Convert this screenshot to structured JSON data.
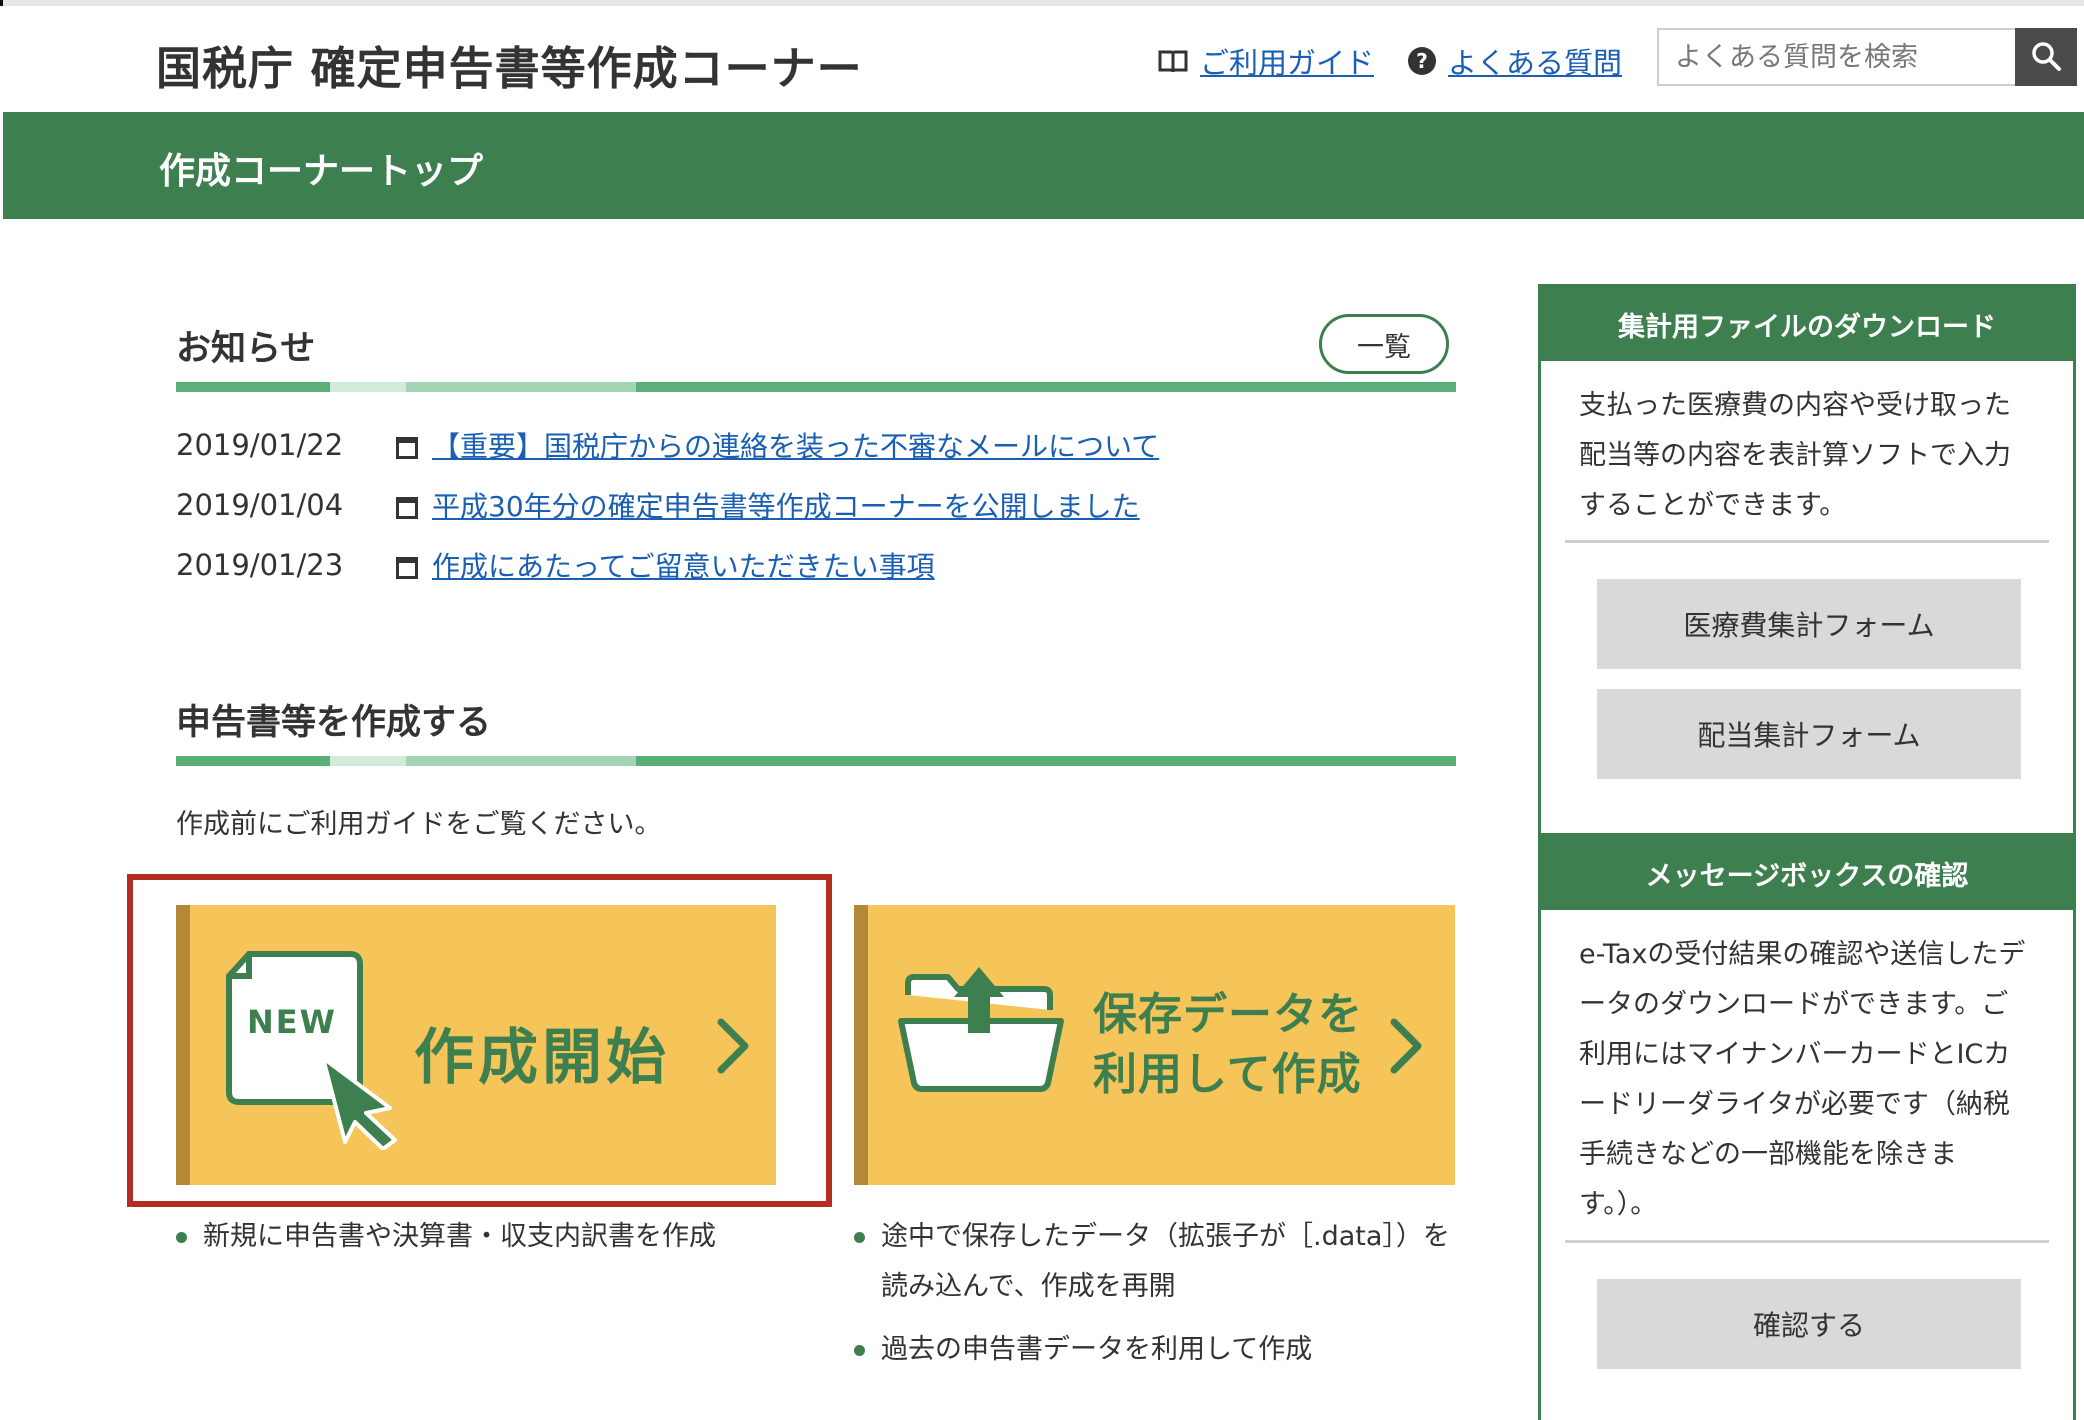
{
  "header": {
    "site_title": "国税庁 確定申告書等作成コーナー",
    "guide_link": "ご利用ガイド",
    "faq_link": "よくある質問",
    "search_placeholder": "よくある質問を検索"
  },
  "band": {
    "title": "作成コーナートップ"
  },
  "news": {
    "title": "お知らせ",
    "list_button": "一覧",
    "items": [
      {
        "date": "2019/01/22",
        "text": "【重要】国税庁からの連絡を装った不審なメールについて"
      },
      {
        "date": "2019/01/04",
        "text": "平成30年分の確定申告書等作成コーナーを公開しました"
      },
      {
        "date": "2019/01/23",
        "text": "作成にあたってご留意いただきたい事項"
      }
    ]
  },
  "create": {
    "title": "申告書等を作成する",
    "note": "作成前にご利用ガイドをご覧ください。",
    "new_badge": "NEW",
    "start_label": "作成開始",
    "saved_label_1": "保存データを",
    "saved_label_2": "利用して作成",
    "start_bullets": [
      "新規に申告書や決算書・収支内訳書を作成"
    ],
    "saved_bullets": [
      "途中で保存したデータ（拡張子が［.data］）を読み込んで、作成を再開",
      "過去の申告書データを利用して作成"
    ]
  },
  "sidebar": {
    "download": {
      "title": "集計用ファイルのダウンロード",
      "desc": "支払った医療費の内容や受け取った配当等の内容を表計算ソフトで入力することができます。",
      "btn_medical": "医療費集計フォーム",
      "btn_dividend": "配当集計フォーム"
    },
    "message": {
      "title": "メッセージボックスの確認",
      "desc": "e-Taxの受付結果の確認や送信したデータのダウンロードができます。ご利用にはマイナンバーカードとICカードリーダライタが必要です（納税手続きなどの一部機能を除きます。）。",
      "btn_confirm": "確認する"
    }
  },
  "colors": {
    "brand_green": "#3d7f4f",
    "card_yellow": "#f5c55a",
    "link_blue": "#1a5fb4",
    "highlight_red": "#b22d22"
  }
}
